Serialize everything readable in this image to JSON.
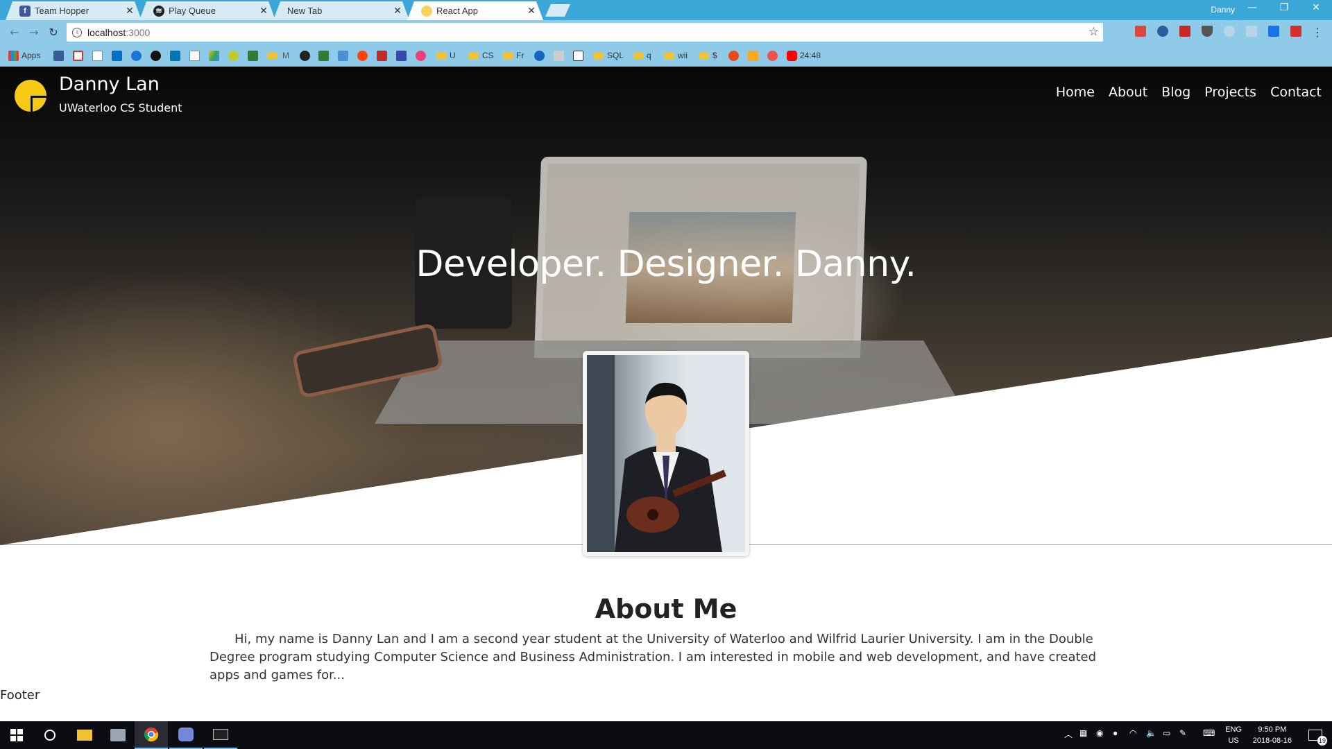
{
  "browser": {
    "tabs": [
      {
        "label": "Team Hopper",
        "icon": "facebook-icon"
      },
      {
        "label": "Play Queue",
        "icon": "spotify-icon"
      },
      {
        "label": "New Tab",
        "icon": ""
      },
      {
        "label": "React App",
        "icon": "react-icon"
      }
    ],
    "profile": "Danny",
    "url_host": "localhost",
    "url_port": ":3000",
    "bookmarks": [
      {
        "label": "Apps"
      },
      {
        "label": "U"
      },
      {
        "label": "CS"
      },
      {
        "label": "Fr"
      },
      {
        "label": "SQL"
      },
      {
        "label": "q"
      },
      {
        "label": "wii"
      },
      {
        "label": "$"
      },
      {
        "label": "24:48"
      }
    ]
  },
  "site": {
    "name": "Danny Lan",
    "subtitle": "UWaterloo CS Student",
    "nav": [
      "Home",
      "About",
      "Blog",
      "Projects",
      "Contact"
    ],
    "tagline": "Developer. Designer. Danny.",
    "about_title": "About Me",
    "about_text": "Hi, my name is Danny Lan and I am a second year student at the University of Waterloo and Wilfrid Laurier University. I am in the Double Degree program studying Computer Science and Business Administration. I am interested in mobile and web development, and have created apps and games for...",
    "footer": "Footer",
    "accent_color": "#f6c915"
  },
  "taskbar": {
    "lang": "ENG",
    "region": "US",
    "time": "9:50 PM",
    "date": "2018-08-16",
    "notifications": "19"
  }
}
